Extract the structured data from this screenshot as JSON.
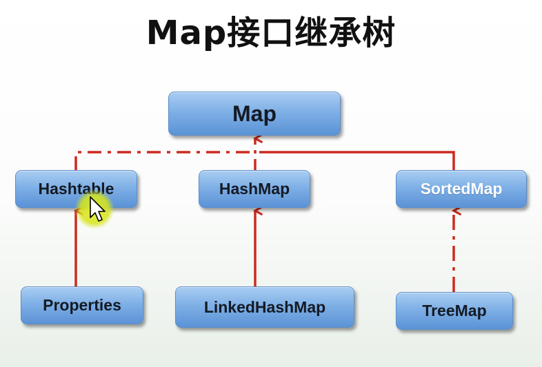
{
  "title": "Map接口继承树",
  "nodes": {
    "map": "Map",
    "hashtable": "Hashtable",
    "hashmap": "HashMap",
    "sortedmap": "SortedMap",
    "properties": "Properties",
    "linkedhashmap": "LinkedHashMap",
    "treemap": "TreeMap"
  },
  "colors": {
    "edge": "#cc2a1e",
    "node_fill": "#7fb0e6",
    "node_border": "#5d8ec9"
  }
}
